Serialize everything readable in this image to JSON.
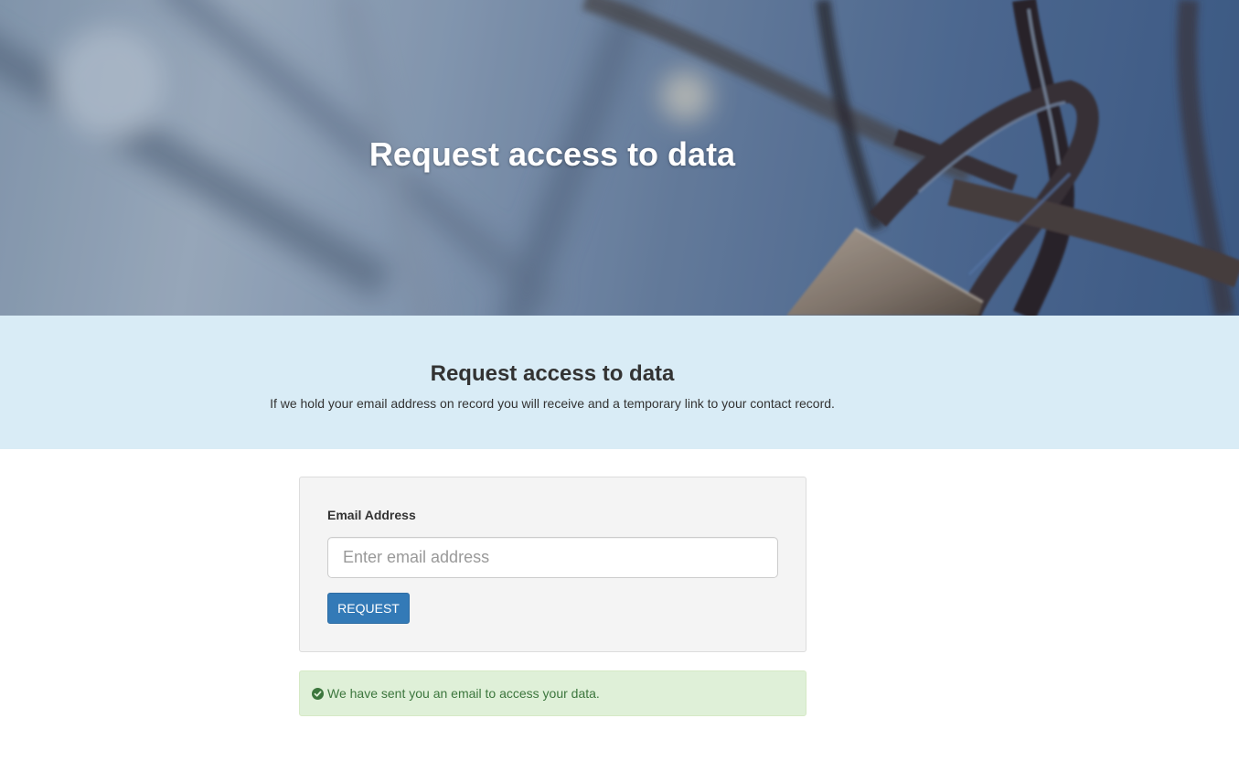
{
  "hero": {
    "title": "Request access to data"
  },
  "intro": {
    "heading": "Request access to data",
    "text": "If we hold your email address on record you will receive and a temporary link to your contact record."
  },
  "form": {
    "email_label": "Email Address",
    "email_placeholder": "Enter email address",
    "email_value": "",
    "submit_label": "REQUEST"
  },
  "alert": {
    "icon": "check-circle-icon",
    "message": "We have sent you an email to access your data."
  },
  "colors": {
    "band_background": "#d9ecf6",
    "button_primary": "#337ab7",
    "alert_background": "#dff0d8",
    "alert_text": "#3c763d"
  }
}
